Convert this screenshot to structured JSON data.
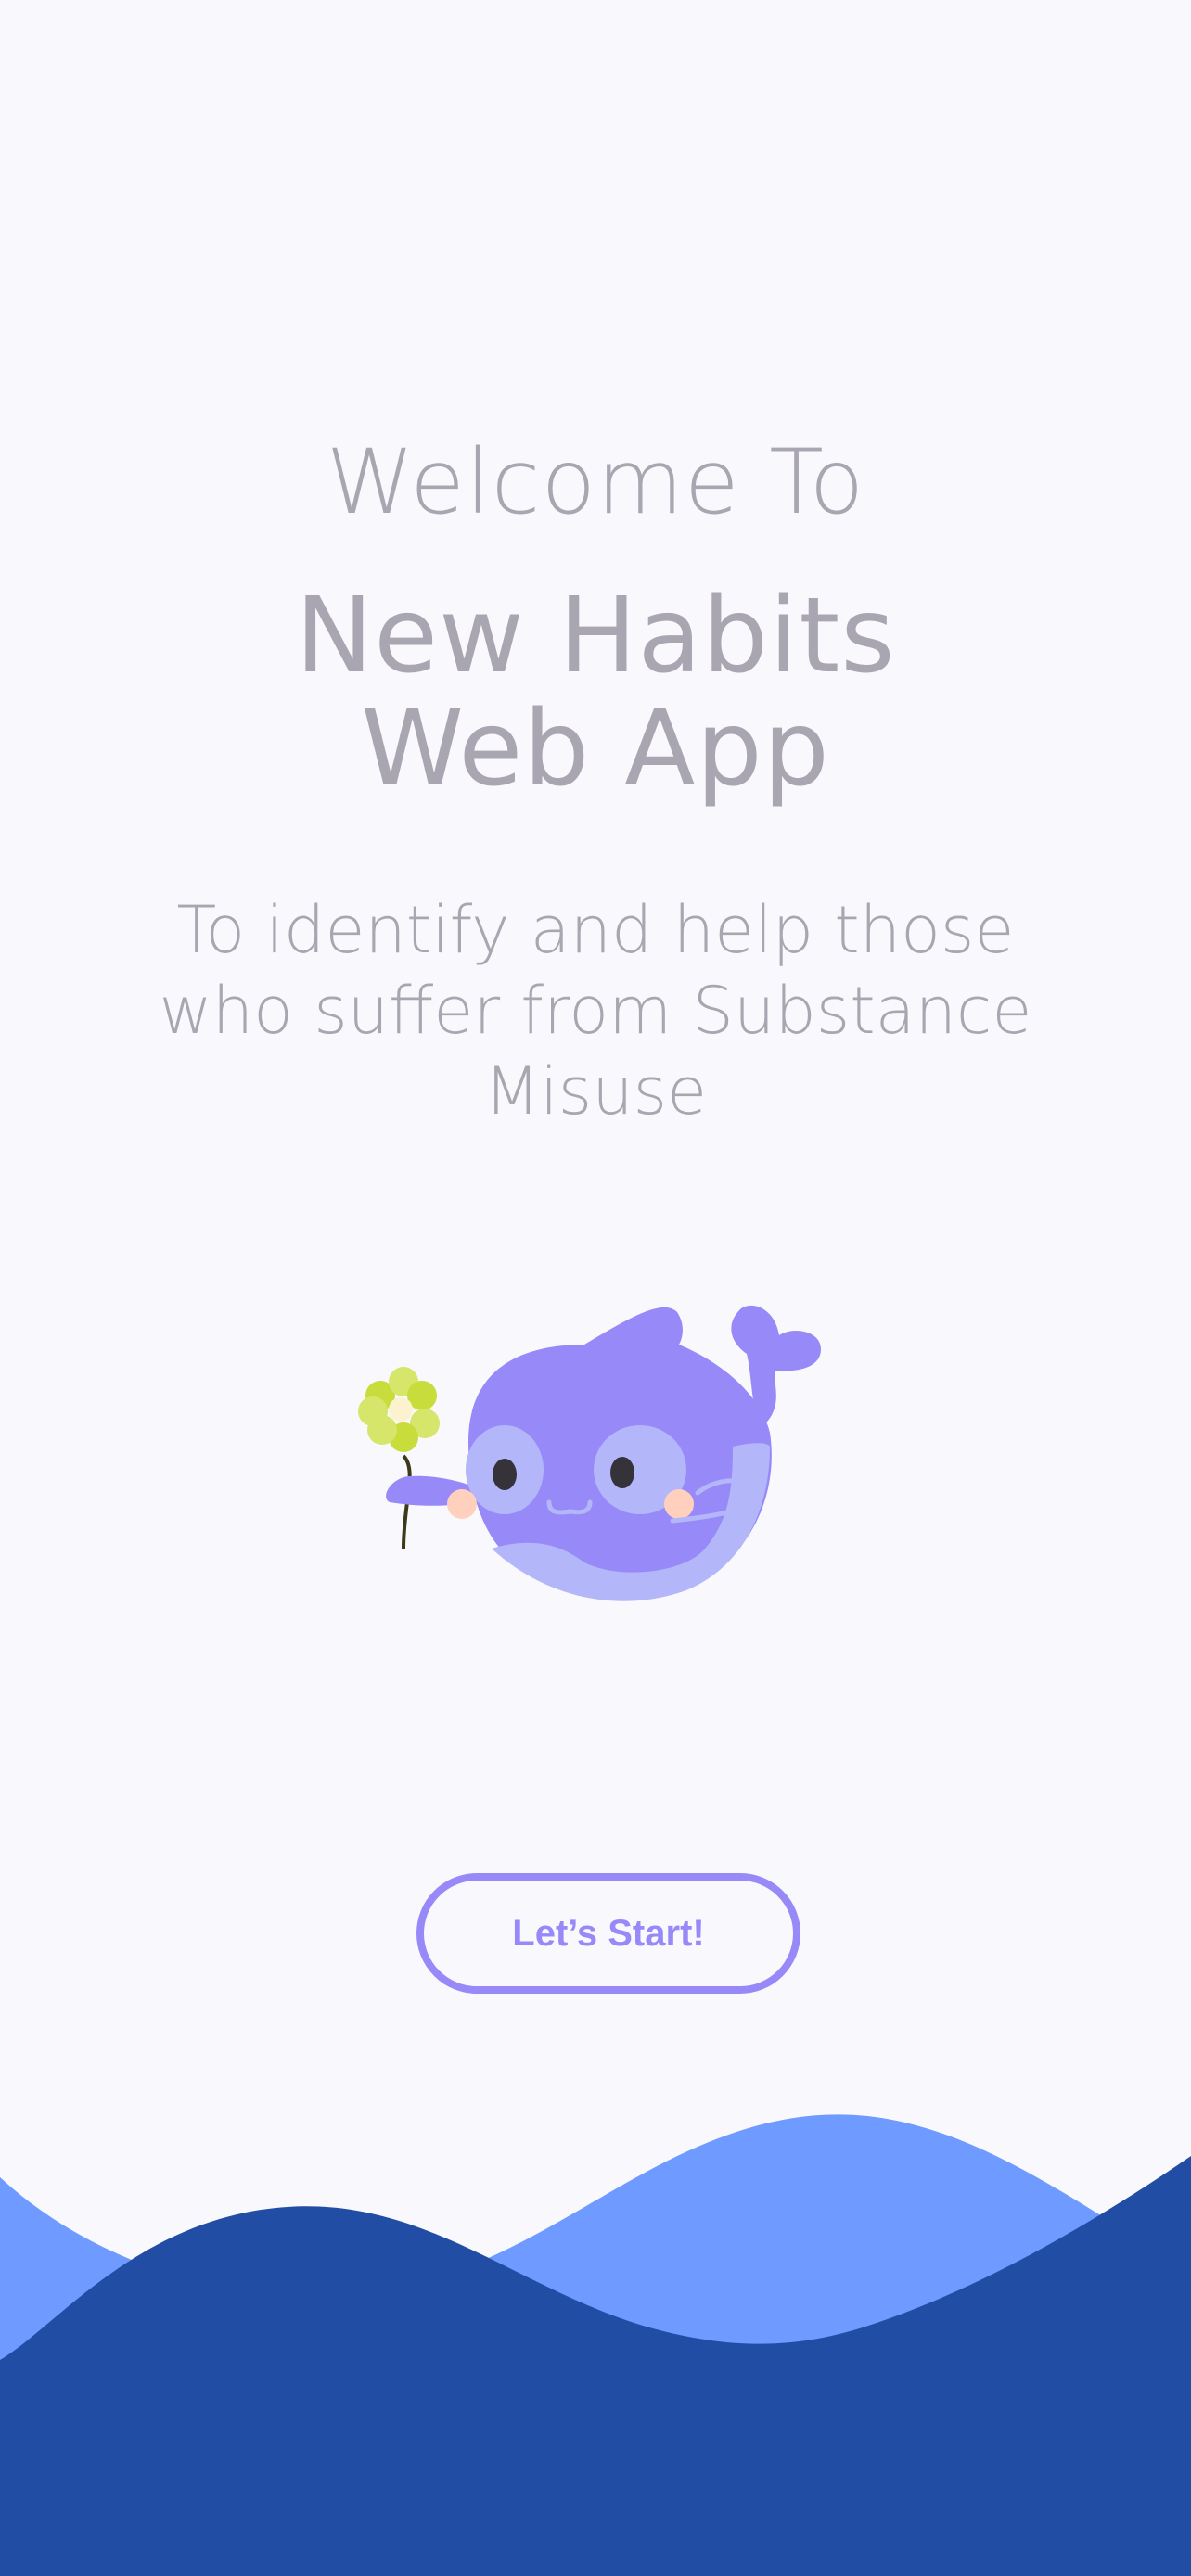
{
  "welcome": {
    "heading": "Welcome To",
    "app_name_line1": "New Habits",
    "app_name_line2": "Web App",
    "tagline": "To identify and help those who suffer from Substance Misuse"
  },
  "start_button_label": "Let’s Start!",
  "colors": {
    "background": "#f9f9fd",
    "text": "#a9a6b2",
    "accent": "#978af8",
    "wave_light": "#6f9aff",
    "wave_dark": "#214ea4"
  },
  "illustration": {
    "subject": "whale-mascot",
    "holding": "flower"
  }
}
